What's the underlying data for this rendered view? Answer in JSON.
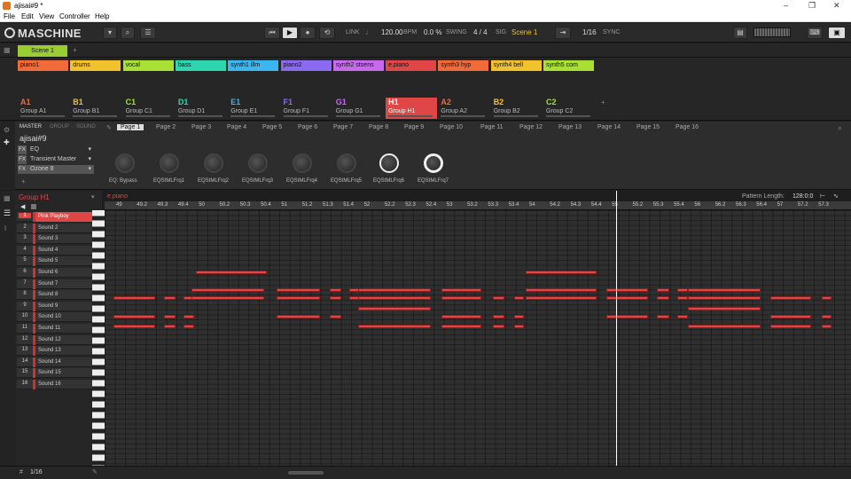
{
  "window": {
    "title": "ajisai#9 *",
    "min": "–",
    "max": "❐",
    "close": "✕"
  },
  "menu": [
    "File",
    "Edit",
    "View",
    "Controller",
    "Help"
  ],
  "header": {
    "logo": "MASCHINE",
    "link": "LINK",
    "bpm": "120.00",
    "bpm_unit": "BPM",
    "swing": "0.0 %",
    "swing_label": "SWING",
    "sig": "4 / 4",
    "sig_label": "SIG",
    "scene": "Scene 1",
    "grid": "1/16",
    "sync": "SYNC"
  },
  "scene": {
    "label": "Scene 1",
    "plus": "+"
  },
  "patterns": [
    {
      "label": "piano1",
      "color": "#f06a3a"
    },
    {
      "label": "drums",
      "color": "#f2c12e"
    },
    {
      "label": "vocal",
      "color": "#a8e034"
    },
    {
      "label": "bass",
      "color": "#2ed6b0"
    },
    {
      "label": "synth1 illm",
      "color": "#3ab6f0"
    },
    {
      "label": "piano2",
      "color": "#8a6af0"
    },
    {
      "label": "synth2 stsens",
      "color": "#c86af0"
    },
    {
      "label": "e.piano",
      "color": "#e04646"
    },
    {
      "label": "synth3 hyp",
      "color": "#f06a3a"
    },
    {
      "label": "synth4 bell",
      "color": "#f2c12e"
    },
    {
      "label": "synth5 com",
      "color": "#a8e034"
    }
  ],
  "groups": [
    {
      "letter": "A1",
      "name": "Group A1",
      "color": "#f06a3a"
    },
    {
      "letter": "B1",
      "name": "Group B1",
      "color": "#f2c12e"
    },
    {
      "letter": "C1",
      "name": "Group C1",
      "color": "#a8e034"
    },
    {
      "letter": "D1",
      "name": "Group D1",
      "color": "#2ed6b0"
    },
    {
      "letter": "E1",
      "name": "Group E1",
      "color": "#3ab6f0"
    },
    {
      "letter": "F1",
      "name": "Group F1",
      "color": "#8a6af0"
    },
    {
      "letter": "G1",
      "name": "Group G1",
      "color": "#c86af0"
    },
    {
      "letter": "H1",
      "name": "Group H1",
      "color": "#e04646"
    },
    {
      "letter": "A2",
      "name": "Group A2",
      "color": "#f06a3a"
    },
    {
      "letter": "B2",
      "name": "Group B2",
      "color": "#f2c12e"
    },
    {
      "letter": "C2",
      "name": "Group C2",
      "color": "#a8e034"
    }
  ],
  "group_plus": "+",
  "module_tabs": [
    "MASTER",
    "GROUP",
    "SOUND"
  ],
  "project_name": "ajisai#9",
  "fx": [
    {
      "slot": "FX",
      "name": "EQ"
    },
    {
      "slot": "FX",
      "name": "Transient Master"
    },
    {
      "slot": "FX",
      "name": "Ozone 8"
    }
  ],
  "fx_plus": "+",
  "pages": [
    "Page 1",
    "Page 2",
    "Page 3",
    "Page 4",
    "Page 5",
    "Page 6",
    "Page 7",
    "Page 8",
    "Page 9",
    "Page 10",
    "Page 11",
    "Page 12",
    "Page 13",
    "Page 14",
    "Page 15",
    "Page 16"
  ],
  "knobs": [
    "EQ: Bypass",
    "EQStMLFrq1",
    "EQStMLFrq2",
    "EQStMLFrq3",
    "EQStMLFrq4",
    "EQStMLFrq5",
    "EQStMLFrq6",
    "EQStMLFrq7"
  ],
  "editor": {
    "group_title": "Group H1",
    "pattern_name": "e.piano",
    "pattern_length_label": "Pattern Length:",
    "pattern_length": "128:0:0",
    "footer_grid": "1/16"
  },
  "sounds": [
    "Pink Playboy",
    "Sound 2",
    "Sound 3",
    "Sound 4",
    "Sound 5",
    "Sound 6",
    "Sound 7",
    "Sound 8",
    "Sound 9",
    "Sound 10",
    "Sound 11",
    "Sound 12",
    "Sound 13",
    "Sound 14",
    "Sound 15",
    "Sound 16"
  ],
  "ruler": [
    "49",
    "49.2",
    "49.3",
    "49.4",
    "50",
    "50.2",
    "50.3",
    "50.4",
    "51",
    "51.2",
    "51.3",
    "51.4",
    "52",
    "52.2",
    "52.3",
    "52.4",
    "53",
    "53.2",
    "53.3",
    "53.4",
    "54",
    "54.2",
    "54.3",
    "54.4",
    "55",
    "55.2",
    "55.3",
    "55.4",
    "56",
    "56.2",
    "56.3",
    "56.4",
    "57",
    "57.2",
    "57.3"
  ]
}
